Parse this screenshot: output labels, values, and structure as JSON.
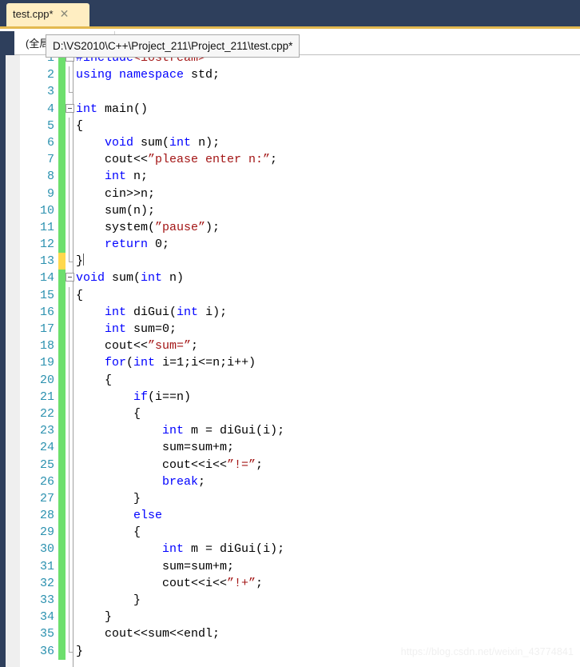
{
  "tab": {
    "title": "test.cpp*",
    "close_label": "✕"
  },
  "navbar": {
    "scope_label": "(全局"
  },
  "tooltip": {
    "path": "D:\\VS2010\\C++\\Project_211\\Project_211\\test.cpp*"
  },
  "watermark": {
    "text": "https://blog.csdn.net/weixin_43774841"
  },
  "colors": {
    "chrome": "#2e3f5c",
    "tab_bg": "#ffeec2",
    "tab_underline": "#e3b94f",
    "keyword": "#0000ff",
    "string": "#a31515",
    "linenumber": "#2b91af",
    "change_saved": "#6ddf6d",
    "change_unsaved": "#ffd84d"
  },
  "editor": {
    "lines": [
      {
        "n": "1",
        "marker": "saved",
        "fold": "open",
        "indent": 0,
        "tokens": [
          {
            "t": "#include",
            "c": "pp"
          },
          {
            "t": "<iostream>",
            "c": "inc"
          }
        ]
      },
      {
        "n": "2",
        "marker": "saved",
        "fold": "bar",
        "indent": 1,
        "tokens": [
          {
            "t": "using namespace",
            "c": "kw"
          },
          {
            "t": " std;",
            "c": ""
          }
        ]
      },
      {
        "n": "3",
        "marker": "saved",
        "fold": "end",
        "indent": 1,
        "tokens": []
      },
      {
        "n": "4",
        "marker": "saved",
        "fold": "open",
        "indent": 0,
        "tokens": [
          {
            "t": "int",
            "c": "kw"
          },
          {
            "t": " main()",
            "c": ""
          }
        ]
      },
      {
        "n": "5",
        "marker": "saved",
        "fold": "bar",
        "indent": 1,
        "tokens": [
          {
            "t": "{",
            "c": ""
          }
        ]
      },
      {
        "n": "6",
        "marker": "saved",
        "fold": "bar",
        "indent": 1,
        "tokens": [
          {
            "t": "    ",
            "c": ""
          },
          {
            "t": "void",
            "c": "kw"
          },
          {
            "t": " sum(",
            "c": ""
          },
          {
            "t": "int",
            "c": "kw"
          },
          {
            "t": " n);",
            "c": ""
          }
        ]
      },
      {
        "n": "7",
        "marker": "saved",
        "fold": "bar",
        "indent": 1,
        "tokens": [
          {
            "t": "    cout<<",
            "c": ""
          },
          {
            "t": "”please enter n:”",
            "c": "str"
          },
          {
            "t": ";",
            "c": ""
          }
        ]
      },
      {
        "n": "8",
        "marker": "saved",
        "fold": "bar",
        "indent": 1,
        "tokens": [
          {
            "t": "    ",
            "c": ""
          },
          {
            "t": "int",
            "c": "kw"
          },
          {
            "t": " n;",
            "c": ""
          }
        ]
      },
      {
        "n": "9",
        "marker": "saved",
        "fold": "bar",
        "indent": 1,
        "tokens": [
          {
            "t": "    cin>>n;",
            "c": ""
          }
        ]
      },
      {
        "n": "10",
        "marker": "saved",
        "fold": "bar",
        "indent": 1,
        "tokens": [
          {
            "t": "    sum(n);",
            "c": ""
          }
        ]
      },
      {
        "n": "11",
        "marker": "saved",
        "fold": "bar",
        "indent": 1,
        "tokens": [
          {
            "t": "    system(",
            "c": ""
          },
          {
            "t": "”pause”",
            "c": "str"
          },
          {
            "t": ");",
            "c": ""
          }
        ]
      },
      {
        "n": "12",
        "marker": "saved",
        "fold": "bar",
        "indent": 1,
        "tokens": [
          {
            "t": "    ",
            "c": ""
          },
          {
            "t": "return",
            "c": "kw"
          },
          {
            "t": " 0;",
            "c": ""
          }
        ]
      },
      {
        "n": "13",
        "marker": "unsaved",
        "fold": "end",
        "indent": 1,
        "tokens": [
          {
            "t": "}",
            "c": ""
          }
        ],
        "caret": true
      },
      {
        "n": "14",
        "marker": "saved",
        "fold": "open",
        "indent": 0,
        "tokens": [
          {
            "t": "void",
            "c": "kw"
          },
          {
            "t": " sum(",
            "c": ""
          },
          {
            "t": "int",
            "c": "kw"
          },
          {
            "t": " n)",
            "c": ""
          }
        ]
      },
      {
        "n": "15",
        "marker": "saved",
        "fold": "bar",
        "indent": 1,
        "tokens": [
          {
            "t": "{",
            "c": ""
          }
        ]
      },
      {
        "n": "16",
        "marker": "saved",
        "fold": "bar",
        "indent": 1,
        "tokens": [
          {
            "t": "    ",
            "c": ""
          },
          {
            "t": "int",
            "c": "kw"
          },
          {
            "t": " diGui(",
            "c": ""
          },
          {
            "t": "int",
            "c": "kw"
          },
          {
            "t": " i);",
            "c": ""
          }
        ]
      },
      {
        "n": "17",
        "marker": "saved",
        "fold": "bar",
        "indent": 1,
        "tokens": [
          {
            "t": "    ",
            "c": ""
          },
          {
            "t": "int",
            "c": "kw"
          },
          {
            "t": " sum=0;",
            "c": ""
          }
        ]
      },
      {
        "n": "18",
        "marker": "saved",
        "fold": "bar",
        "indent": 1,
        "tokens": [
          {
            "t": "    cout<<",
            "c": ""
          },
          {
            "t": "”sum=”",
            "c": "str"
          },
          {
            "t": ";",
            "c": ""
          }
        ]
      },
      {
        "n": "19",
        "marker": "saved",
        "fold": "bar",
        "indent": 1,
        "tokens": [
          {
            "t": "    ",
            "c": ""
          },
          {
            "t": "for",
            "c": "kw"
          },
          {
            "t": "(",
            "c": ""
          },
          {
            "t": "int",
            "c": "kw"
          },
          {
            "t": " i=1;i<=n;i++)",
            "c": ""
          }
        ]
      },
      {
        "n": "20",
        "marker": "saved",
        "fold": "bar",
        "indent": 1,
        "tokens": [
          {
            "t": "    {",
            "c": ""
          }
        ]
      },
      {
        "n": "21",
        "marker": "saved",
        "fold": "bar",
        "indent": 1,
        "tokens": [
          {
            "t": "        ",
            "c": ""
          },
          {
            "t": "if",
            "c": "kw"
          },
          {
            "t": "(i==n)",
            "c": ""
          }
        ]
      },
      {
        "n": "22",
        "marker": "saved",
        "fold": "bar",
        "indent": 1,
        "tokens": [
          {
            "t": "        {",
            "c": ""
          }
        ]
      },
      {
        "n": "23",
        "marker": "saved",
        "fold": "bar",
        "indent": 1,
        "tokens": [
          {
            "t": "            ",
            "c": ""
          },
          {
            "t": "int",
            "c": "kw"
          },
          {
            "t": " m = diGui(i);",
            "c": ""
          }
        ]
      },
      {
        "n": "24",
        "marker": "saved",
        "fold": "bar",
        "indent": 1,
        "tokens": [
          {
            "t": "            sum=sum+m;",
            "c": ""
          }
        ]
      },
      {
        "n": "25",
        "marker": "saved",
        "fold": "bar",
        "indent": 1,
        "tokens": [
          {
            "t": "            cout<<i<<",
            "c": ""
          },
          {
            "t": "”!=”",
            "c": "str"
          },
          {
            "t": ";",
            "c": ""
          }
        ]
      },
      {
        "n": "26",
        "marker": "saved",
        "fold": "bar",
        "indent": 1,
        "tokens": [
          {
            "t": "            ",
            "c": ""
          },
          {
            "t": "break",
            "c": "kw"
          },
          {
            "t": ";",
            "c": ""
          }
        ]
      },
      {
        "n": "27",
        "marker": "saved",
        "fold": "bar",
        "indent": 1,
        "tokens": [
          {
            "t": "        }",
            "c": ""
          }
        ]
      },
      {
        "n": "28",
        "marker": "saved",
        "fold": "bar",
        "indent": 1,
        "tokens": [
          {
            "t": "        ",
            "c": ""
          },
          {
            "t": "else",
            "c": "kw"
          }
        ]
      },
      {
        "n": "29",
        "marker": "saved",
        "fold": "bar",
        "indent": 1,
        "tokens": [
          {
            "t": "        {",
            "c": ""
          }
        ]
      },
      {
        "n": "30",
        "marker": "saved",
        "fold": "bar",
        "indent": 1,
        "tokens": [
          {
            "t": "            ",
            "c": ""
          },
          {
            "t": "int",
            "c": "kw"
          },
          {
            "t": " m = diGui(i);",
            "c": ""
          }
        ]
      },
      {
        "n": "31",
        "marker": "saved",
        "fold": "bar",
        "indent": 1,
        "tokens": [
          {
            "t": "            sum=sum+m;",
            "c": ""
          }
        ]
      },
      {
        "n": "32",
        "marker": "saved",
        "fold": "bar",
        "indent": 1,
        "tokens": [
          {
            "t": "            cout<<i<<",
            "c": ""
          },
          {
            "t": "”!+”",
            "c": "str"
          },
          {
            "t": ";",
            "c": ""
          }
        ]
      },
      {
        "n": "33",
        "marker": "saved",
        "fold": "bar",
        "indent": 1,
        "tokens": [
          {
            "t": "        }",
            "c": ""
          }
        ]
      },
      {
        "n": "34",
        "marker": "saved",
        "fold": "bar",
        "indent": 1,
        "tokens": [
          {
            "t": "    }",
            "c": ""
          }
        ]
      },
      {
        "n": "35",
        "marker": "saved",
        "fold": "bar",
        "indent": 1,
        "tokens": [
          {
            "t": "    cout<<sum<<endl;",
            "c": ""
          }
        ]
      },
      {
        "n": "36",
        "marker": "saved",
        "fold": "end",
        "indent": 1,
        "tokens": [
          {
            "t": "}",
            "c": ""
          }
        ]
      }
    ]
  }
}
